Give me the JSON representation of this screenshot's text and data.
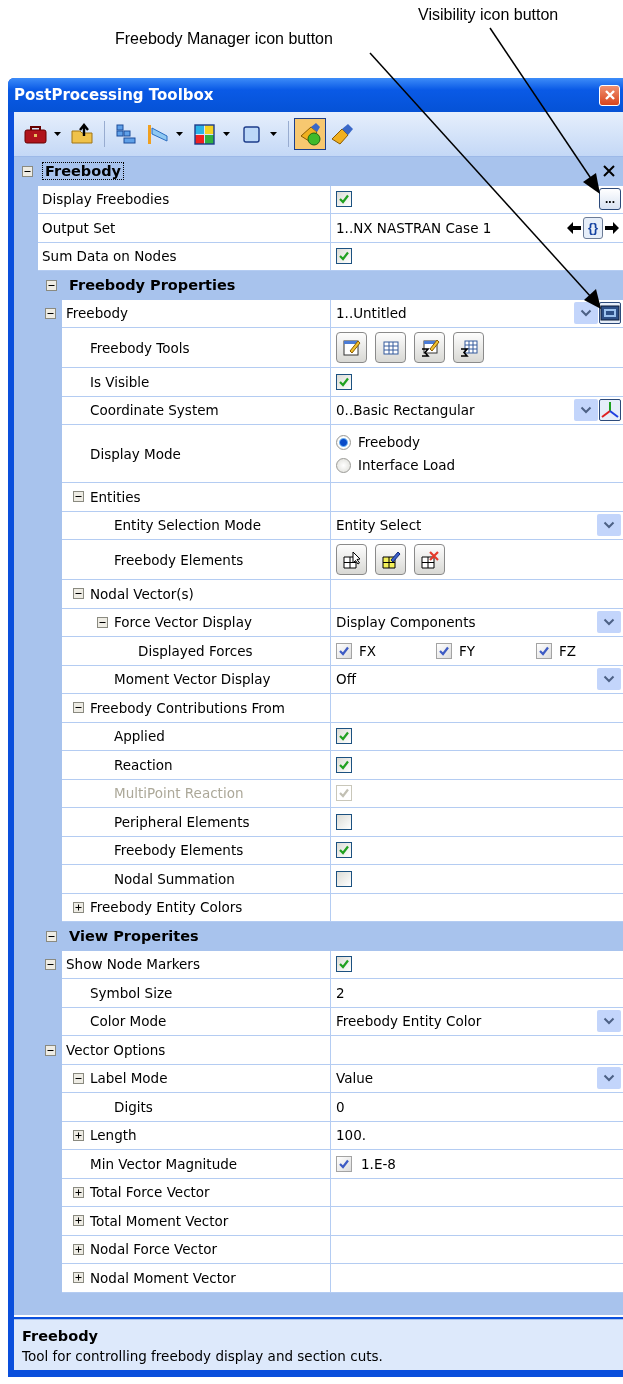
{
  "callouts": [
    {
      "text": "Visibility icon button"
    },
    {
      "text": "Freebody Manager icon button"
    }
  ],
  "window": {
    "title": "PostProcessing Toolbox"
  },
  "toolbar": [
    {
      "kind": "split",
      "pressed": false
    },
    {
      "kind": "button",
      "pressed": false
    },
    {
      "kind": "separator"
    },
    {
      "kind": "button",
      "pressed": false
    },
    {
      "kind": "split",
      "pressed": false
    },
    {
      "kind": "split",
      "pressed": false
    },
    {
      "kind": "split",
      "pressed": false
    },
    {
      "kind": "separator"
    },
    {
      "kind": "button",
      "pressed": true
    },
    {
      "kind": "button",
      "pressed": false
    }
  ],
  "grid": [
    {
      "kind": "category",
      "title": "Freebody",
      "expanded": true,
      "focused": true,
      "closable": true,
      "children": [
        {
          "kind": "property",
          "label": "Display Freebodies",
          "value": {
            "kind": "check",
            "checked": true,
            "disabled": false,
            "side_button": "..."
          }
        },
        {
          "kind": "property",
          "label": "Output Set",
          "value": {
            "kind": "output",
            "text": "1..NX NASTRAN Case 1",
            "picker": "{}"
          }
        },
        {
          "kind": "property",
          "label": "Sum Data on Nodes",
          "value": {
            "kind": "check",
            "checked": true,
            "disabled": false
          }
        },
        {
          "kind": "category",
          "title": "Freebody Properties",
          "expanded": true,
          "focused": false,
          "children": [
            {
              "kind": "property",
              "label": "Freebody",
              "expanded": true,
              "value": {
                "kind": "manager-select",
                "text": "1..Untitled"
              },
              "children": [
                {
                  "kind": "property",
                  "label": "Freebody Tools",
                  "value": {
                    "kind": "tools"
                  }
                },
                {
                  "kind": "property",
                  "label": "Is Visible",
                  "value": {
                    "kind": "check",
                    "checked": true,
                    "disabled": false
                  }
                },
                {
                  "kind": "property",
                  "label": "Coordinate System",
                  "value": {
                    "kind": "axes-select",
                    "text": "0..Basic Rectangular"
                  }
                },
                {
                  "kind": "property",
                  "label": "Display Mode",
                  "value": {
                    "kind": "radio",
                    "options": [
                      {
                        "label": "Freebody",
                        "selected": true
                      },
                      {
                        "label": "Interface Load",
                        "selected": false
                      }
                    ]
                  }
                },
                {
                  "kind": "property",
                  "label": "Entities",
                  "expanded": true,
                  "children": [
                    {
                      "kind": "property",
                      "label": "Entity Selection Mode",
                      "value": {
                        "kind": "select",
                        "text": "Entity Select"
                      }
                    },
                    {
                      "kind": "property",
                      "label": "Freebody Elements",
                      "value": {
                        "kind": "element-tools"
                      }
                    }
                  ]
                },
                {
                  "kind": "property",
                  "label": "Nodal Vector(s)",
                  "expanded": true,
                  "children": [
                    {
                      "kind": "property",
                      "label": "Force Vector Display",
                      "expanded": true,
                      "value": {
                        "kind": "select",
                        "text": "Display Components"
                      },
                      "children": [
                        {
                          "kind": "property",
                          "label": "Displayed Forces",
                          "value": {
                            "kind": "checks",
                            "options": [
                              {
                                "label": "FX",
                                "checked": true
                              },
                              {
                                "label": "FY",
                                "checked": true
                              },
                              {
                                "label": "FZ",
                                "checked": true
                              }
                            ]
                          }
                        }
                      ]
                    },
                    {
                      "kind": "property",
                      "label": "Moment Vector Display",
                      "value": {
                        "kind": "select",
                        "text": "Off"
                      }
                    }
                  ]
                },
                {
                  "kind": "property",
                  "label": "Freebody Contributions From",
                  "expanded": true,
                  "children": [
                    {
                      "kind": "property",
                      "label": "Applied",
                      "value": {
                        "kind": "check",
                        "checked": true,
                        "disabled": false
                      }
                    },
                    {
                      "kind": "property",
                      "label": "Reaction",
                      "value": {
                        "kind": "check",
                        "checked": true,
                        "disabled": false
                      }
                    },
                    {
                      "kind": "property",
                      "label": "MultiPoint Reaction",
                      "value": {
                        "kind": "check",
                        "checked": true,
                        "disabled": true
                      }
                    },
                    {
                      "kind": "property",
                      "label": "Peripheral Elements",
                      "value": {
                        "kind": "check",
                        "checked": false,
                        "disabled": false
                      }
                    },
                    {
                      "kind": "property",
                      "label": "Freebody Elements",
                      "value": {
                        "kind": "check",
                        "checked": true,
                        "disabled": false
                      }
                    },
                    {
                      "kind": "property",
                      "label": "Nodal Summation",
                      "value": {
                        "kind": "check",
                        "checked": false,
                        "disabled": false
                      }
                    }
                  ]
                },
                {
                  "kind": "property",
                  "label": "Freebody Entity Colors",
                  "expanded": false
                }
              ]
            }
          ]
        },
        {
          "kind": "category",
          "title": "View Properites",
          "expanded": true,
          "focused": false,
          "children": [
            {
              "kind": "property",
              "label": "Show Node Markers",
              "expanded": true,
              "value": {
                "kind": "check",
                "checked": true,
                "disabled": false
              },
              "children": [
                {
                  "kind": "property",
                  "label": "Symbol Size",
                  "value": {
                    "kind": "text",
                    "text": "2"
                  }
                },
                {
                  "kind": "property",
                  "label": "Color Mode",
                  "value": {
                    "kind": "select",
                    "text": "Freebody Entity Color"
                  }
                }
              ]
            },
            {
              "kind": "property",
              "label": "Vector Options",
              "expanded": true,
              "children": [
                {
                  "kind": "property",
                  "label": "Label Mode",
                  "expanded": true,
                  "value": {
                    "kind": "select",
                    "text": "Value"
                  },
                  "children": [
                    {
                      "kind": "property",
                      "label": "Digits",
                      "value": {
                        "kind": "text",
                        "text": "0"
                      }
                    }
                  ]
                },
                {
                  "kind": "property",
                  "label": "Length",
                  "expanded": false,
                  "value": {
                    "kind": "text",
                    "text": "100."
                  }
                },
                {
                  "kind": "property",
                  "label": "Min Vector Magnitude",
                  "value": {
                    "kind": "checktext",
                    "checked": true,
                    "text": "1.E-8"
                  }
                },
                {
                  "kind": "property",
                  "label": "Total Force Vector",
                  "expanded": false
                },
                {
                  "kind": "property",
                  "label": "Total Moment Vector",
                  "expanded": false
                },
                {
                  "kind": "property",
                  "label": "Nodal Force Vector",
                  "expanded": false
                },
                {
                  "kind": "property",
                  "label": "Nodal Moment Vector",
                  "expanded": false
                }
              ]
            }
          ]
        }
      ]
    }
  ],
  "help": {
    "title": "Freebody",
    "text": "Tool for controlling freebody display and section cuts."
  }
}
